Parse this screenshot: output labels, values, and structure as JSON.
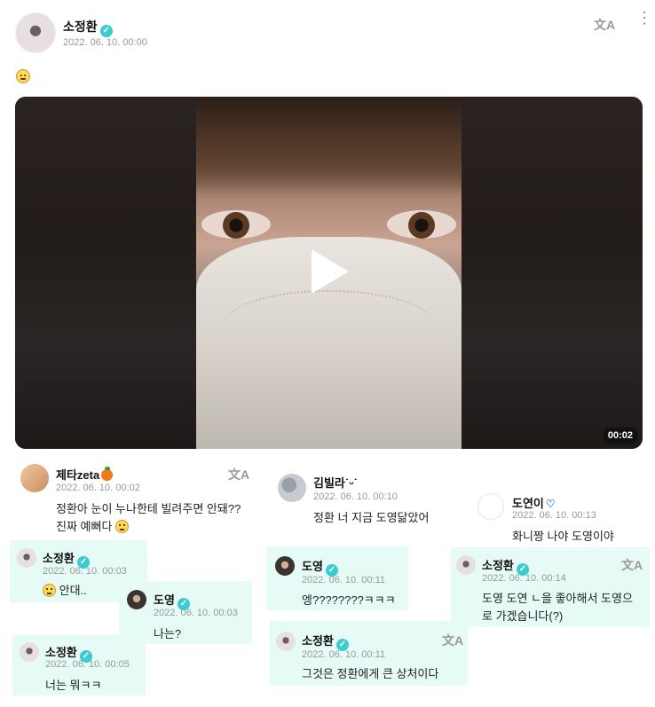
{
  "post": {
    "author": "소정환",
    "timestamp": "2022. 06. 10. 00:00",
    "translate_icon": "translate-icon",
    "more_icon": "more-vertical-icon",
    "more_glyph": "⋮",
    "translate_glyph": "文A",
    "verified_glyph": "✓",
    "body_emoji": "slightly-smiling-face-emoji"
  },
  "video": {
    "duration": "00:02",
    "play_icon": "play-icon"
  },
  "comments": [
    {
      "author": "제타zeta",
      "timestamp": "2022. 06. 10. 00:02",
      "text_line1": "정환아 눈이 누나한테 빌려주면 안돼??",
      "text_line2": "진짜 예뻐다"
    },
    {
      "author": "김빌라˙ᵕ˙",
      "timestamp": "2022. 06. 10. 00:10",
      "text": "정환 너 지금 도영닮았어"
    },
    {
      "author": "도연이",
      "timestamp": "2022. 06. 10. 00:13",
      "text": "화니짱 나야 도영이야"
    }
  ],
  "replies": [
    {
      "author": "소정환",
      "timestamp": "2022. 06. 10. 00:03",
      "text": "안대.."
    },
    {
      "author": "도영",
      "timestamp": "2022. 06. 10. 00:03",
      "text": "나는?"
    },
    {
      "author": "소정환",
      "timestamp": "2022. 06. 10. 00:05",
      "text": "너는 뭐ㅋㅋ"
    },
    {
      "author": "도영",
      "timestamp": "2022. 06. 10. 00:11",
      "text": "엥????????ㅋㅋㅋ"
    },
    {
      "author": "소정환",
      "timestamp": "2022. 06. 10. 00:11",
      "text": "그것은 정환에게 큰 상처이다"
    },
    {
      "author": "소정환",
      "timestamp": "2022. 06. 10. 00:14",
      "text_line1": "도영 도연 ㄴ을 좋아해서 도영으",
      "text_line2": "로 가겠습니다(?)"
    }
  ],
  "colors": {
    "verified": "#3ccbcf",
    "reply_bg": "#e6fbf6",
    "timestamp": "#999999"
  }
}
